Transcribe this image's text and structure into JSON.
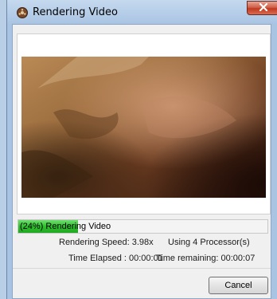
{
  "window": {
    "title": "Rendering Video"
  },
  "progress": {
    "percent": 24,
    "label": "(24%) Rendering Video"
  },
  "stats": {
    "rendering_speed": "Rendering Speed: 3.98x",
    "processors": "Using 4 Processor(s)",
    "time_elapsed": "Time Elapsed  : 00:00:01",
    "time_remaining": "Time remaining: 00:00:07"
  },
  "buttons": {
    "cancel_label": "Cancel"
  },
  "icons": {
    "app": "film-reel-icon",
    "close": "close-icon"
  },
  "colors": {
    "progress_fill": "#2fbf2f",
    "close_button": "#c0391f"
  }
}
